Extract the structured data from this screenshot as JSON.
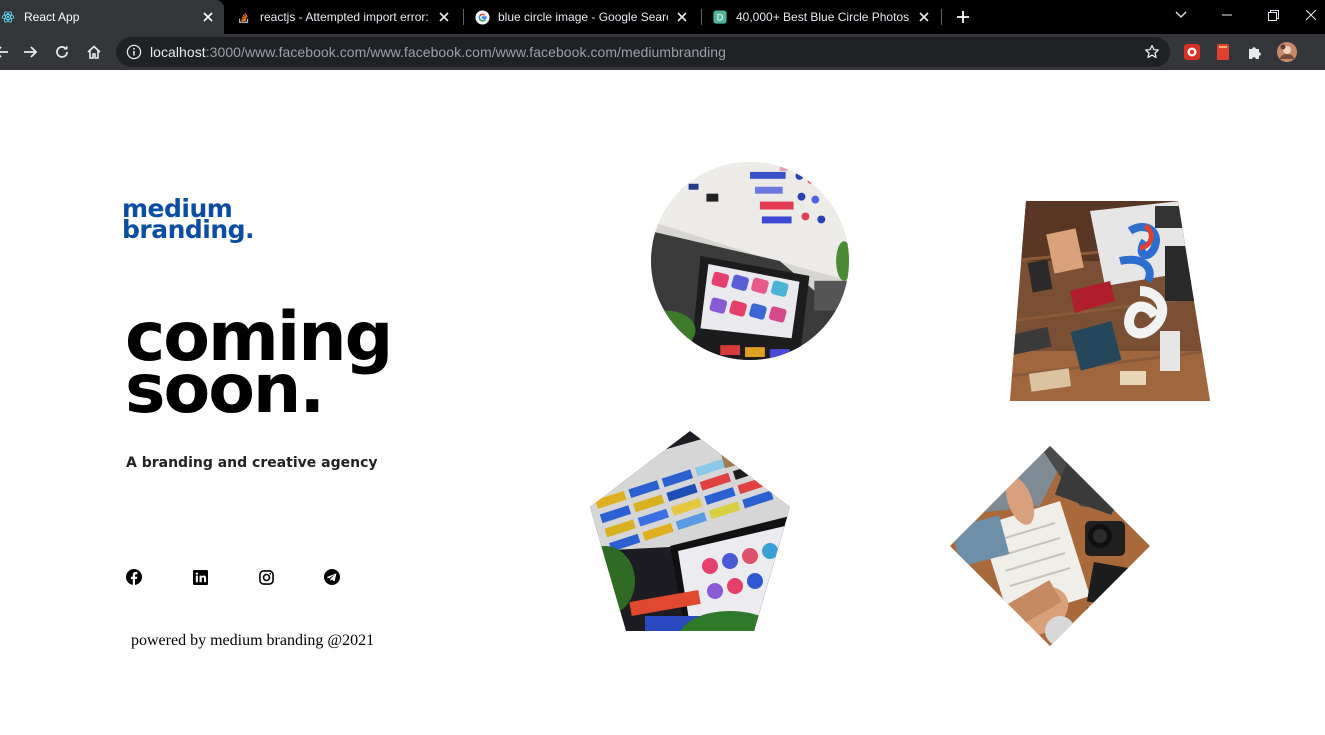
{
  "browser": {
    "tabs": [
      {
        "title": "React App",
        "active": true,
        "favicon": "react-icon"
      },
      {
        "title": "reactjs - Attempted import error:",
        "active": false,
        "favicon": "stackoverflow-icon"
      },
      {
        "title": "blue circle image - Google Search",
        "active": false,
        "favicon": "google-icon"
      },
      {
        "title": "40,000+ Best Blue Circle Photos",
        "active": false,
        "favicon": "d-site-icon"
      }
    ],
    "url_host": "localhost",
    "url_path": ":3000/www.facebook.com/www.facebook.com/www.facebook.com/mediumbranding"
  },
  "page": {
    "logo_line1": "medium",
    "logo_line2": "branding.",
    "headline_line1": "coming",
    "headline_line2": "soon.",
    "tagline": "A branding and creative agency",
    "footer": "powered by medium branding @2021",
    "social_icons": [
      "facebook-icon",
      "linkedin-icon",
      "instagram-icon",
      "telegram-icon"
    ],
    "images": [
      "circle-photo",
      "trapezoid-photo",
      "pentagon-photo",
      "diamond-photo"
    ]
  },
  "colors": {
    "brand_blue": "#0b4da2",
    "headline": "#000000",
    "tabbar_bg": "#000000",
    "toolbar_bg": "#35363a",
    "omnibox_bg": "#202124"
  }
}
